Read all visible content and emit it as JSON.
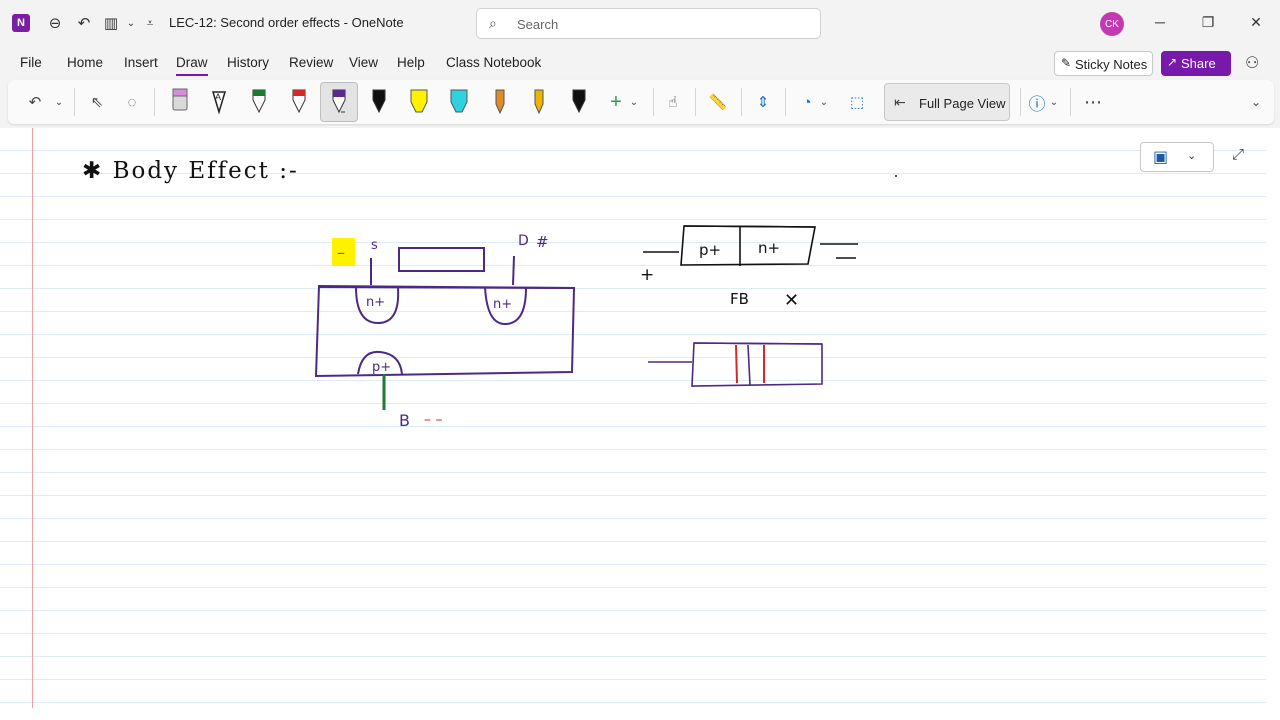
{
  "window": {
    "title": "LEC-12: Second order effects  -  OneNote",
    "search_placeholder": "Search",
    "avatar_initials": "CK"
  },
  "menu": {
    "items": [
      "File",
      "Home",
      "Insert",
      "Draw",
      "History",
      "Review",
      "View",
      "Help",
      "Class Notebook"
    ],
    "active": "Draw",
    "sticky_notes_label": "Sticky Notes",
    "share_label": "Share"
  },
  "ribbon": {
    "full_page_view_label": "Full Page View",
    "pens": [
      {
        "name": "pen-lightgray",
        "color": "#d9d9d9"
      },
      {
        "name": "pen-black-outline",
        "color": "#222222"
      },
      {
        "name": "pen-green",
        "color": "#1e7a32"
      },
      {
        "name": "pen-red",
        "color": "#d62828"
      },
      {
        "name": "pen-purple",
        "color": "#5b2b8c"
      },
      {
        "name": "pen-black",
        "color": "#111111"
      },
      {
        "name": "highlighter-yellow",
        "color": "#fff200"
      },
      {
        "name": "highlighter-cyan",
        "color": "#2fd3e0"
      },
      {
        "name": "pencil-orange",
        "color": "#e08a2b"
      },
      {
        "name": "pencil-yellow",
        "color": "#f0b400"
      },
      {
        "name": "pen-black-2",
        "color": "#111111"
      }
    ]
  },
  "ink": {
    "heading": "✱  Body  Effect :-",
    "labels": {
      "s": "s",
      "d": "D",
      "n_plus_left": "n+",
      "n_plus_right": "n+",
      "p_plus_sub": "p+",
      "b": "B",
      "b_dashes": "– –",
      "minus": "–",
      "diode_p": "p+",
      "diode_n": "n+",
      "plus_sign": "+",
      "fb": "FB",
      "cross": "✕",
      "minus_sign": "–"
    }
  },
  "colors": {
    "accent": "#7719aa",
    "ink_purple": "#4b2a86",
    "ink_red": "#d62828",
    "ink_green": "#1e7a32",
    "highlight_yellow": "#fff200"
  }
}
